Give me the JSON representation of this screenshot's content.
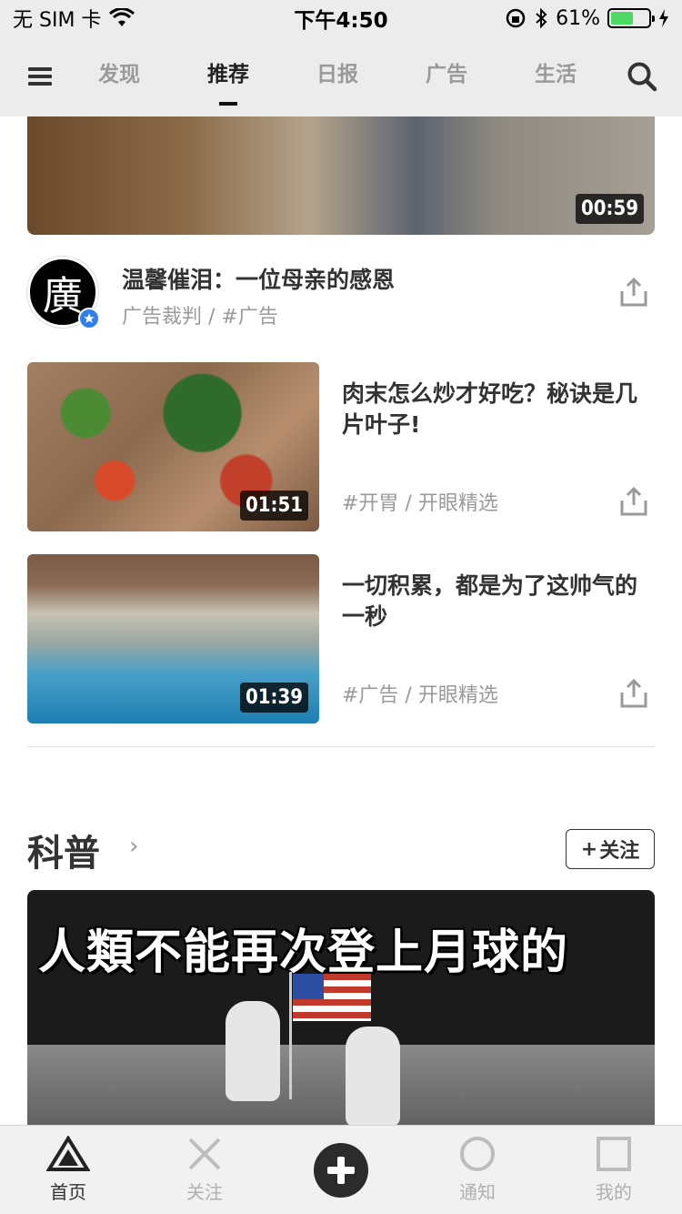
{
  "status_bar": {
    "carrier": "无 SIM 卡",
    "time": "下午4:50",
    "battery": "61%",
    "battery_fill": 0.61
  },
  "top_nav": {
    "tabs": [
      {
        "label": "发现"
      },
      {
        "label": "推荐",
        "active": true
      },
      {
        "label": "日报"
      },
      {
        "label": "广告"
      },
      {
        "label": "生活"
      }
    ]
  },
  "main_card": {
    "duration": "00:59",
    "avatar_text": "廣",
    "title": "温馨催泪：一位母亲的感恩",
    "meta": "广告裁判  /  #广告"
  },
  "list": [
    {
      "duration": "01:51",
      "title": "肉末怎么炒才好吃？秘诀是几片叶子!",
      "meta": "#开胃  /  开眼精选"
    },
    {
      "duration": "01:39",
      "title": "一切积累，都是为了这帅气的一秒",
      "meta": "#广告  /  开眼精选"
    }
  ],
  "section": {
    "title": "科普",
    "follow_label": "关注",
    "video_caption": "人類不能再次登上月球的"
  },
  "tab_bar": {
    "items": [
      {
        "label": "首页",
        "active": true
      },
      {
        "label": "关注"
      },
      {
        "label": ""
      },
      {
        "label": "通知"
      },
      {
        "label": "我的"
      }
    ]
  }
}
